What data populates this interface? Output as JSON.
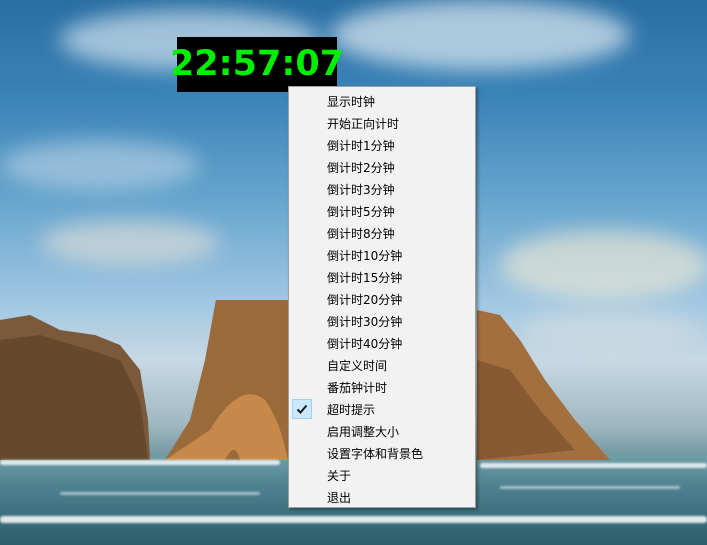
{
  "clock": {
    "time": "22:57:07"
  },
  "context_menu": {
    "items": [
      {
        "label": "显示时钟",
        "checked": false
      },
      {
        "label": "开始正向计时",
        "checked": false
      },
      {
        "label": "倒计时1分钟",
        "checked": false
      },
      {
        "label": "倒计时2分钟",
        "checked": false
      },
      {
        "label": "倒计时3分钟",
        "checked": false
      },
      {
        "label": "倒计时5分钟",
        "checked": false
      },
      {
        "label": "倒计时8分钟",
        "checked": false
      },
      {
        "label": "倒计时10分钟",
        "checked": false
      },
      {
        "label": "倒计时15分钟",
        "checked": false
      },
      {
        "label": "倒计时20分钟",
        "checked": false
      },
      {
        "label": "倒计时30分钟",
        "checked": false
      },
      {
        "label": "倒计时40分钟",
        "checked": false
      },
      {
        "label": "自定义时间",
        "checked": false
      },
      {
        "label": "番茄钟计时",
        "checked": false
      },
      {
        "label": "超时提示",
        "checked": true
      },
      {
        "label": "启用调整大小",
        "checked": false
      },
      {
        "label": "设置字体和背景色",
        "checked": false
      },
      {
        "label": "关于",
        "checked": false
      },
      {
        "label": "退出",
        "checked": false
      }
    ]
  },
  "colors": {
    "clock_text": "#00ee00",
    "clock_background": "#000000",
    "menu_background": "#f2f2f2",
    "check_highlight": "#cce8ff"
  },
  "icons": {
    "checked_item": "checkmark-icon"
  }
}
